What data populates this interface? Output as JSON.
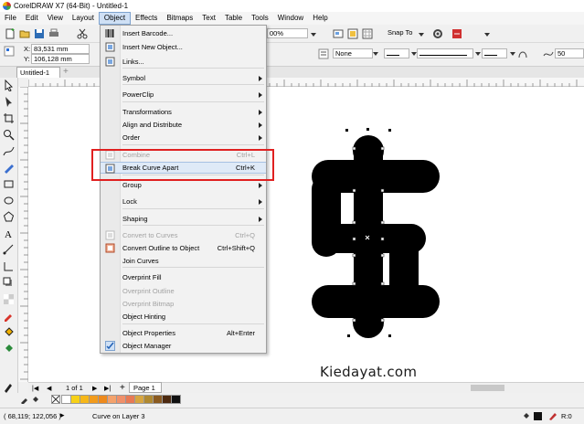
{
  "window": {
    "title": "CorelDRAW X7 (64-Bit) - Untitled-1"
  },
  "menubar": [
    "File",
    "Edit",
    "View",
    "Layout",
    "Object",
    "Effects",
    "Bitmaps",
    "Text",
    "Table",
    "Tools",
    "Window",
    "Help"
  ],
  "menubar_active": "Object",
  "toolbar": {
    "zoom": "00%",
    "snap_to": "Snap To",
    "x_value": "83,531 mm",
    "y_value": "106,128 mm",
    "x_label": "X:",
    "y_label": "Y:",
    "outline_style": "None",
    "angle_value": "50"
  },
  "tabs": {
    "document": "Untitled-1"
  },
  "object_menu": {
    "items": [
      {
        "label": "Insert Barcode...",
        "shortcut": "",
        "submenu": false,
        "disabled": false,
        "icon": "barcode-icon"
      },
      {
        "label": "Insert New Object...",
        "shortcut": "",
        "submenu": false,
        "disabled": false,
        "icon": "new-object-icon"
      },
      {
        "label": "Links...",
        "shortcut": "",
        "submenu": false,
        "disabled": false,
        "icon": "links-icon"
      },
      {
        "label": "Symbol",
        "shortcut": "",
        "submenu": true,
        "disabled": false,
        "icon": ""
      },
      {
        "label": "PowerClip",
        "shortcut": "",
        "submenu": true,
        "disabled": false,
        "icon": ""
      },
      {
        "label": "Transformations",
        "shortcut": "",
        "submenu": true,
        "disabled": false,
        "icon": ""
      },
      {
        "label": "Align and Distribute",
        "shortcut": "",
        "submenu": true,
        "disabled": false,
        "icon": ""
      },
      {
        "label": "Order",
        "shortcut": "",
        "submenu": true,
        "disabled": false,
        "icon": ""
      },
      {
        "label": "Combine",
        "shortcut": "Ctrl+L",
        "submenu": false,
        "disabled": true,
        "icon": "combine-icon"
      },
      {
        "label": "Break Curve Apart",
        "shortcut": "Ctrl+K",
        "submenu": false,
        "disabled": false,
        "icon": "break-apart-icon"
      },
      {
        "label": "Group",
        "shortcut": "",
        "submenu": true,
        "disabled": false,
        "icon": ""
      },
      {
        "label": "Lock",
        "shortcut": "",
        "submenu": true,
        "disabled": false,
        "icon": ""
      },
      {
        "label": "Shaping",
        "shortcut": "",
        "submenu": true,
        "disabled": false,
        "icon": ""
      },
      {
        "label": "Convert to Curves",
        "shortcut": "Ctrl+Q",
        "submenu": false,
        "disabled": true,
        "icon": "convert-curves-icon"
      },
      {
        "label": "Convert Outline to Object",
        "shortcut": "Ctrl+Shift+Q",
        "submenu": false,
        "disabled": false,
        "icon": "outline-to-object-icon"
      },
      {
        "label": "Join Curves",
        "shortcut": "",
        "submenu": false,
        "disabled": false,
        "icon": ""
      },
      {
        "label": "Overprint Fill",
        "shortcut": "",
        "submenu": false,
        "disabled": false,
        "icon": ""
      },
      {
        "label": "Overprint Outline",
        "shortcut": "",
        "submenu": false,
        "disabled": true,
        "icon": ""
      },
      {
        "label": "Overprint Bitmap",
        "shortcut": "",
        "submenu": false,
        "disabled": true,
        "icon": ""
      },
      {
        "label": "Object Hinting",
        "shortcut": "",
        "submenu": false,
        "disabled": false,
        "icon": ""
      },
      {
        "label": "Object Properties",
        "shortcut": "Alt+Enter",
        "submenu": false,
        "disabled": false,
        "icon": ""
      },
      {
        "label": "Object Manager",
        "shortcut": "",
        "submenu": false,
        "disabled": false,
        "icon": "check-icon"
      }
    ]
  },
  "page_nav": {
    "counter": "1 of 1",
    "page_tab": "Page 1"
  },
  "palette": [
    "#ffffff",
    "#f7d117",
    "#f6b718",
    "#f29b1b",
    "#ee8a1d",
    "#f4a26c",
    "#f0906a",
    "#e87a55",
    "#d8a640",
    "#b08930",
    "#8a5a20",
    "#4d2a10",
    "#111111"
  ],
  "status": {
    "coords": "( 68,119; 122,056 )",
    "layer": "Curve on Layer 3",
    "fill_label": "R:0"
  },
  "watermark": "Kiedayat.com",
  "colors": {
    "accent": "#e02020",
    "menu_highlight": "#dfeaf7"
  }
}
